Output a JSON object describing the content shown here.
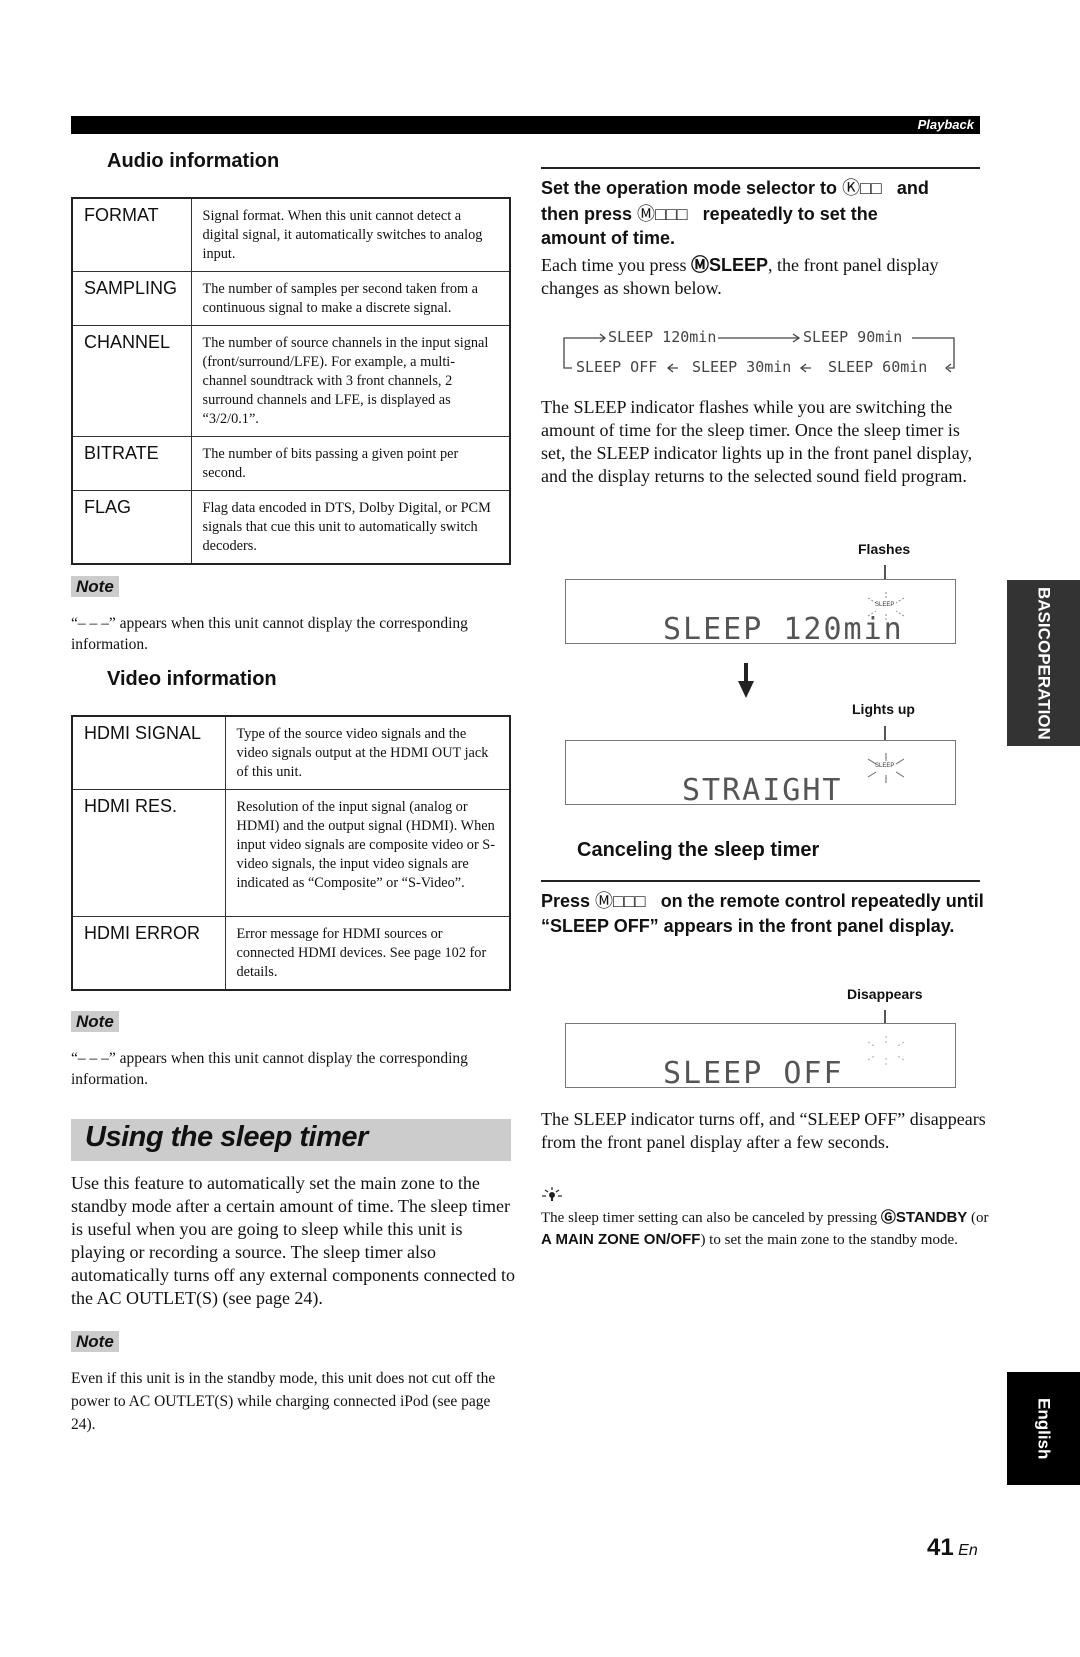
{
  "header": {
    "section_label": "Playback"
  },
  "audio": {
    "title": "Audio information",
    "rows": [
      {
        "key": "FORMAT",
        "desc": "Signal format. When this unit cannot detect a digital signal, it automatically switches to analog input."
      },
      {
        "key": "SAMPLING",
        "desc": "The number of samples per second taken from a continuous signal to make a discrete signal."
      },
      {
        "key": "CHANNEL",
        "desc": "The number of source channels in the input signal (front/surround/LFE). For example, a multi-channel soundtrack with 3 front channels, 2 surround channels and LFE, is displayed as “3/2/0.1”."
      },
      {
        "key": "BITRATE",
        "desc": "The number of bits passing a given point per second."
      },
      {
        "key": "FLAG",
        "desc": "Flag data encoded in DTS, Dolby Digital, or PCM signals that cue this unit to automatically switch decoders."
      }
    ],
    "note_label": "Note",
    "note_text": "“– – –” appears when this unit cannot display the corresponding information."
  },
  "video": {
    "title": "Video information",
    "rows": [
      {
        "key": "HDMI SIGNAL",
        "desc": "Type of the source video signals and the video signals output at the HDMI OUT jack of this unit."
      },
      {
        "key": "HDMI RES.",
        "desc": "Resolution of the input signal (analog or HDMI) and the output signal (HDMI). When input video signals are composite video or S-video signals, the input video signals are indicated as “Composite” or “S-Video”."
      },
      {
        "key": "HDMI ERROR",
        "desc": "Error message for HDMI sources or connected HDMI devices. See page 102 for details."
      }
    ],
    "note_label": "Note",
    "note_text": "“– – –” appears when this unit cannot display the corresponding information."
  },
  "sleep": {
    "title": "Using the sleep timer",
    "intro": "Use this feature to automatically set the main zone to the standby mode after a certain amount of time. The sleep timer is useful when you are going to sleep while this unit is playing or recording a source. The sleep timer also automatically turns off any external components connected to the AC OUTLET(S) (see page 24).",
    "note_label": "Note",
    "note_text": "Even if this unit is in the standby mode, this unit does not cut off the power to AC OUTLET(S) while charging connected iPod (see page 24).",
    "step": {
      "line1_a": "Set the operation mode selector to ",
      "key1": "Ⓚ□□",
      "line1_b": "and",
      "line2_a": "then press ",
      "key2": "Ⓜ□□□",
      "line2_b": "repeatedly to set the",
      "line3": "amount of time."
    },
    "each_time_a": "Each time you press ",
    "each_time_key": "ⓂSLEEP",
    "each_time_b": ", the front panel display changes as shown below.",
    "sequence": {
      "s1": "SLEEP 120min",
      "s2": "SLEEP 90min",
      "s3": "SLEEP 60min",
      "s4": "SLEEP 30min",
      "s5": "SLEEP OFF"
    },
    "indicator_text": "The SLEEP indicator flashes while you are switching the amount of time for the sleep timer. Once the sleep timer is set, the SLEEP indicator lights up in the front panel display, and the display returns to the selected sound field program.",
    "display1": {
      "callout": "Flashes",
      "text": "SLEEP 120min",
      "indicator": "SLEEP"
    },
    "display2": {
      "callout": "Lights up",
      "text": "STRAIGHT",
      "indicator": "SLEEP"
    },
    "cancel": {
      "title": "Canceling the sleep timer",
      "step_a": "Press ",
      "step_key": "Ⓜ□□□",
      "step_b": "on the remote control repeatedly until “SLEEP OFF” appears in the front panel display.",
      "display": {
        "callout": "Disappears",
        "text": "SLEEP OFF"
      },
      "after_text": "The SLEEP indicator turns off, and “SLEEP OFF” disappears from the front panel display after a few seconds.",
      "tip_a": "The sleep timer setting can also be canceled by pressing ",
      "tip_key1": "ⒼSTANDBY",
      "tip_b": " (or ",
      "tip_key2": "A  MAIN ZONE ON/OFF",
      "tip_c": ") to set the main zone to the standby mode."
    }
  },
  "side_tabs": {
    "basic_line1": "BASIC",
    "basic_line2": "OPERATION",
    "language": "English"
  },
  "footer": {
    "page_number": "41",
    "page_suffix": "En"
  }
}
